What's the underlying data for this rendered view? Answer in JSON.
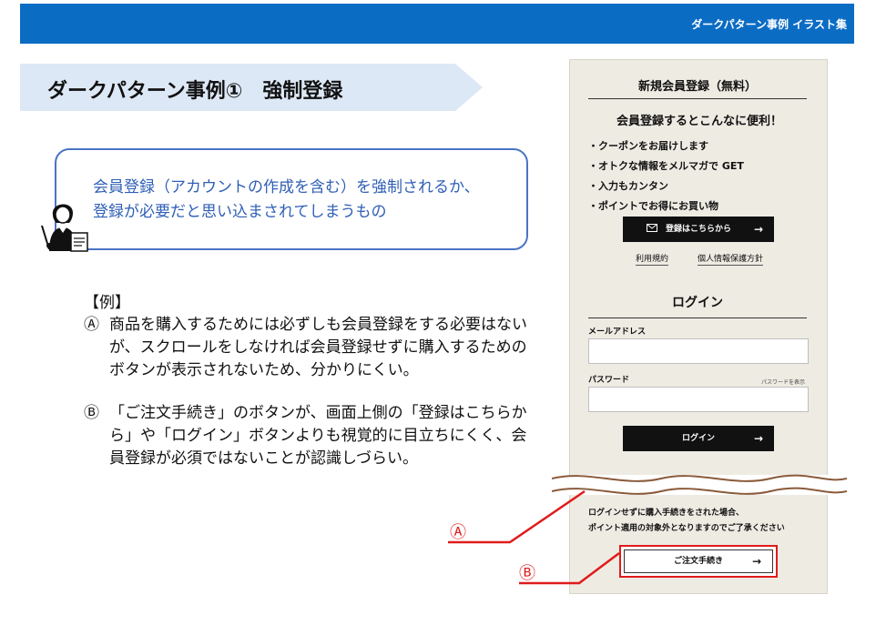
{
  "header": {
    "title": "ダークパターン事例 イラスト集"
  },
  "slide": {
    "title": "ダークパターン事例①　強制登録"
  },
  "callout": {
    "line1": "会員登録（アカウントの作成を含む）を強制されるか、",
    "line2": "登録が必要だと思い込まされてしまうもの"
  },
  "example": {
    "heading": "【例】",
    "items": [
      {
        "marker": "Ⓐ",
        "text": "商品を購入するためには必ずしも会員登録をする必要はないが、スクロールをしなければ会員登録せずに購入するためのボタンが表示されないため、分かりにくい。"
      },
      {
        "marker": "Ⓑ",
        "text": "「ご注文手続き」のボタンが、画面上側の「登録はこちらから」や「ログイン」ボタンよりも視覚的に目立ちにくく、会員登録が必須ではないことが認識しづらい。"
      }
    ]
  },
  "mock": {
    "register_title": "新規会員登録（無料）",
    "benefit_title": "会員登録するとこんなに便利！",
    "benefits": [
      "・クーポンをお届けします",
      "・オトクな情報をメルマガで GET",
      "・入力もカンタン",
      "・ポイントでお得にお買い物"
    ],
    "register_button": "登録はこちらから",
    "arrow": "→",
    "terms_link": "利用規約",
    "privacy_link": "個人情報保護方針",
    "login_title": "ログイン",
    "email_label": "メールアドレス",
    "password_label": "パスワード",
    "show_password": "パスワードを表示",
    "login_button": "ログイン",
    "notice_line1": "ログインせずに購入手続きをされた場合、",
    "notice_line2": "ポイント適用の対象外となりますのでご了承ください",
    "order_button": "ご注文手続き"
  },
  "annotations": {
    "a": "Ⓐ",
    "b": "Ⓑ"
  },
  "colors": {
    "header_blue": "#0b6cc4",
    "title_band": "#dde8f6",
    "callout_border": "#4a74c4",
    "callout_text": "#2f5fb6",
    "panel_bg": "#eeebe3",
    "annotation_red": "#e01b1b",
    "wave_brown": "#8a5a3a"
  },
  "icons": {
    "person": "person-at-laptop-icon",
    "mail": "mail-icon",
    "arrow": "arrow-right-icon"
  }
}
